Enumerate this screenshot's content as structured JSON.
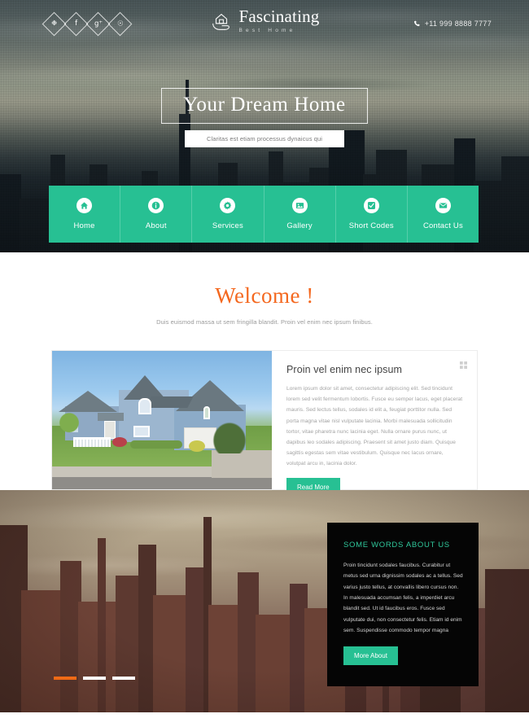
{
  "header": {
    "social": [
      {
        "name": "twitter-icon",
        "glyph": "❉"
      },
      {
        "name": "facebook-icon",
        "glyph": "f"
      },
      {
        "name": "google-plus-icon",
        "glyph": "g⁺"
      },
      {
        "name": "dribbble-icon",
        "glyph": "☉"
      }
    ],
    "brand_name": "Fascinating",
    "brand_tagline": "Best Home",
    "phone": "+11 999 8888 7777"
  },
  "hero": {
    "headline": "Your Dream Home",
    "subline": "Claritas est etiam processus dynaicus qui"
  },
  "nav": {
    "items": [
      {
        "label": "Home",
        "icon": "home-icon"
      },
      {
        "label": "About",
        "icon": "info-icon"
      },
      {
        "label": "Services",
        "icon": "gear-icon"
      },
      {
        "label": "Gallery",
        "icon": "image-icon"
      },
      {
        "label": "Short Codes",
        "icon": "check-square-icon"
      },
      {
        "label": "Contact Us",
        "icon": "envelope-icon"
      }
    ]
  },
  "welcome": {
    "title": "Welcome !",
    "subtitle": "Duis euismod massa ut sem fringilla blandit. Proin vel enim nec ipsum finibus."
  },
  "card": {
    "title": "Proin vel enim nec ipsum",
    "body": "Lorem ipsum dolor sit amet, consectetur adipiscing elit. Sed tincidunt lorem sed velit fermentum lobortis. Fusce eu semper lacus, eget placerat mauris. Sed lectus tellus, sodales id elit a, feugiat porttitor nulla. Sed porta magna vitae nisl vulputate lacinia. Morbi malesuada sollicitudin tortor, vitae pharetra nunc lacinia eget. Nulla ornare purus nunc, ut dapibus leo sodales adipiscing. Praesent sit amet justo diam. Quisque sagittis egestas sem vitae vestibulum. Quisque nec lacus ornare, volutpat arcu in, lacinia dolor.",
    "read_more_label": "Read More"
  },
  "about": {
    "title": "SOME WORDS ABOUT US",
    "body": "Proin tincidunt sodales faucibus. Curabitur ut metus sed urna dignissim sodales ac a tellus. Sed varius justo tellus, at convallis libero cursus non. In malesuada accumsan felis, a imperdiet arcu blandit sed. Ut id faucibus eros. Fusce sed vulputate dui, non consectetur felis. Etiam id enim sem. Suspendisse commodo tempor magna",
    "more_about_label": "More About",
    "slides": [
      {
        "active": true
      },
      {
        "active": false
      },
      {
        "active": false
      }
    ]
  },
  "colors": {
    "accent_green": "#27c093",
    "accent_orange": "#f4681f",
    "panel_black": "#050505",
    "about_title_green": "#2fc79a",
    "pager_active": "#ef6a16"
  }
}
